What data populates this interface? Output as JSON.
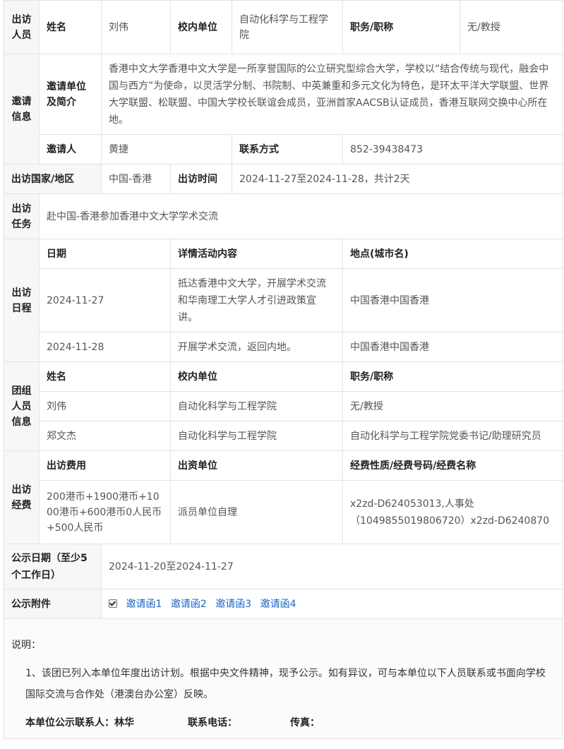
{
  "visitors": {
    "section": "出访人员",
    "name_label": "姓名",
    "name": "刘伟",
    "unit_label": "校内单位",
    "unit": "自动化科学与工程学院",
    "title_label": "职务/职称",
    "title": "无/教授"
  },
  "invitation": {
    "section": "邀请信息",
    "org_label": "邀请单位及简介",
    "org_desc": "香港中文大学香港中文大学是一所享誉国际的公立研究型综合大学，学校以“结合传统与现代，融会中国与西方”为使命，以灵活学分制、书院制、中英兼重和多元文化为特色，是环太平洋大学联盟、世界大学联盟、松联盟、中国大学校长联谊会成员，亚洲首家AACSB认证成员，香港互联网交换中心所在地。",
    "inviter_label": "邀请人",
    "inviter": "黄捷",
    "contact_label": "联系方式",
    "contact": "852-39438473"
  },
  "destination": {
    "country_label": "出访国家/地区",
    "country": "中国-香港",
    "time_label": "出访时间",
    "time": "2024-11-27至2024-11-28，共计2天"
  },
  "task": {
    "section": "出访任务",
    "text": "赴中国-香港参加香港中文大学学术交流"
  },
  "schedule": {
    "section": "出访日程",
    "headers": [
      "日期",
      "详情活动内容",
      "地点(城市名)"
    ],
    "rows": [
      {
        "date": "2024-11-27",
        "detail": "抵达香港中文大学，开展学术交流和华南理工大学人才引进政策宣讲。",
        "place": "中国香港中国香港"
      },
      {
        "date": "2024-11-28",
        "detail": "开展学术交流，返回内地。",
        "place": "中国香港中国香港"
      }
    ]
  },
  "group": {
    "section": "团组人员信息",
    "headers": [
      "姓名",
      "校内单位",
      "职务/职称"
    ],
    "rows": [
      {
        "name": "刘伟",
        "unit": "自动化科学与工程学院",
        "title": "无/教授"
      },
      {
        "name": "郑文杰",
        "unit": "自动化科学与工程学院",
        "title": "自动化科学与工程学院党委书记/助理研究员"
      }
    ]
  },
  "funding": {
    "section": "出访经费",
    "headers": [
      "出访费用",
      "出资单位",
      "经费性质/经费号码/经费名称"
    ],
    "cost": "200港币+1900港币+1000港币+600港币0人民币+500人民币",
    "payer": "派员单位自理",
    "nature": "x2zd-D624053013,人事处（1049855019806720）x2zd-D6240870"
  },
  "publicity": {
    "date_label": "公示日期（至少5个工作日）",
    "date": "2024-11-20至2024-11-27",
    "attach_label": "公示附件",
    "attachments": [
      "邀请函1",
      "邀请函2",
      "邀请函3",
      "邀请函4"
    ]
  },
  "notes": {
    "heading": "说明：",
    "item1": "1、该团已列入本单位年度出访计划。根据中央文件精神，现予公示。如有异议，可与本单位以下人员联系或书面向学校国际交流与合作处（港澳台办公室）反映。",
    "contact_person": "本单位公示联系人：林华",
    "phone": "联系电话：",
    "fax": "传真："
  }
}
